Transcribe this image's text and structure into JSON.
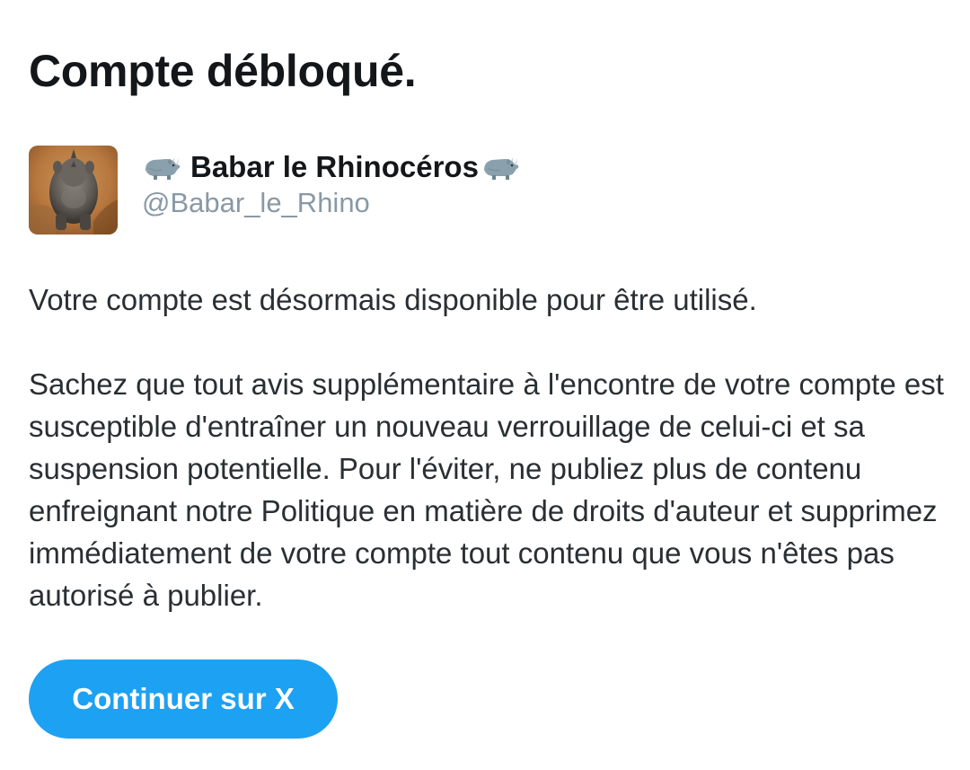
{
  "page": {
    "title": "Compte débloqué."
  },
  "user": {
    "display_name": "Babar le Rhinocéros",
    "handle": "@Babar_le_Rhino",
    "avatar_icon": "rhino-photo",
    "name_decoration_icon": "rhinoceros-emoji"
  },
  "message": {
    "paragraph_1": "Votre compte est désormais disponible pour être utilisé.",
    "paragraph_2": "Sachez que tout avis supplémentaire à l'encontre de votre compte est susceptible d'entraîner un nouveau verrouillage de celui-ci et sa suspension potentielle. Pour l'éviter, ne publiez plus de contenu enfreignant notre Politique en matière de droits d'auteur et supprimez immédiatement de votre compte tout contenu que vous n'êtes pas autorisé à publier."
  },
  "actions": {
    "continue_label": "Continuer sur X"
  },
  "colors": {
    "button_background": "#1da1f2",
    "title_text": "#14171a",
    "body_text": "#292f33",
    "handle_text": "#8899a6"
  }
}
